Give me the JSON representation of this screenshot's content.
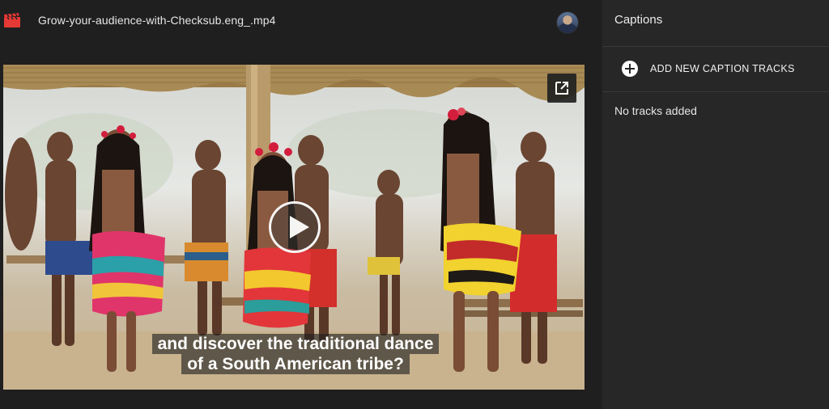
{
  "header": {
    "file_icon": "clapperboard-icon",
    "file_name": "Grow-your-audience-with-Checksub.eng_.mp4",
    "avatar_icon": "user-avatar"
  },
  "video": {
    "popout_icon": "open-in-new-icon",
    "play_icon": "play-icon",
    "subtitle_lines": [
      "and discover the traditional dance",
      "of a South American tribe?"
    ]
  },
  "captions_panel": {
    "title": "Captions",
    "add_button_label": "ADD NEW CAPTION TRACKS",
    "add_icon": "add-circle-icon",
    "empty_message": "No tracks added"
  },
  "colors": {
    "background": "#1f1f1f",
    "panel": "#272727",
    "accent_icon": "#e53935"
  }
}
